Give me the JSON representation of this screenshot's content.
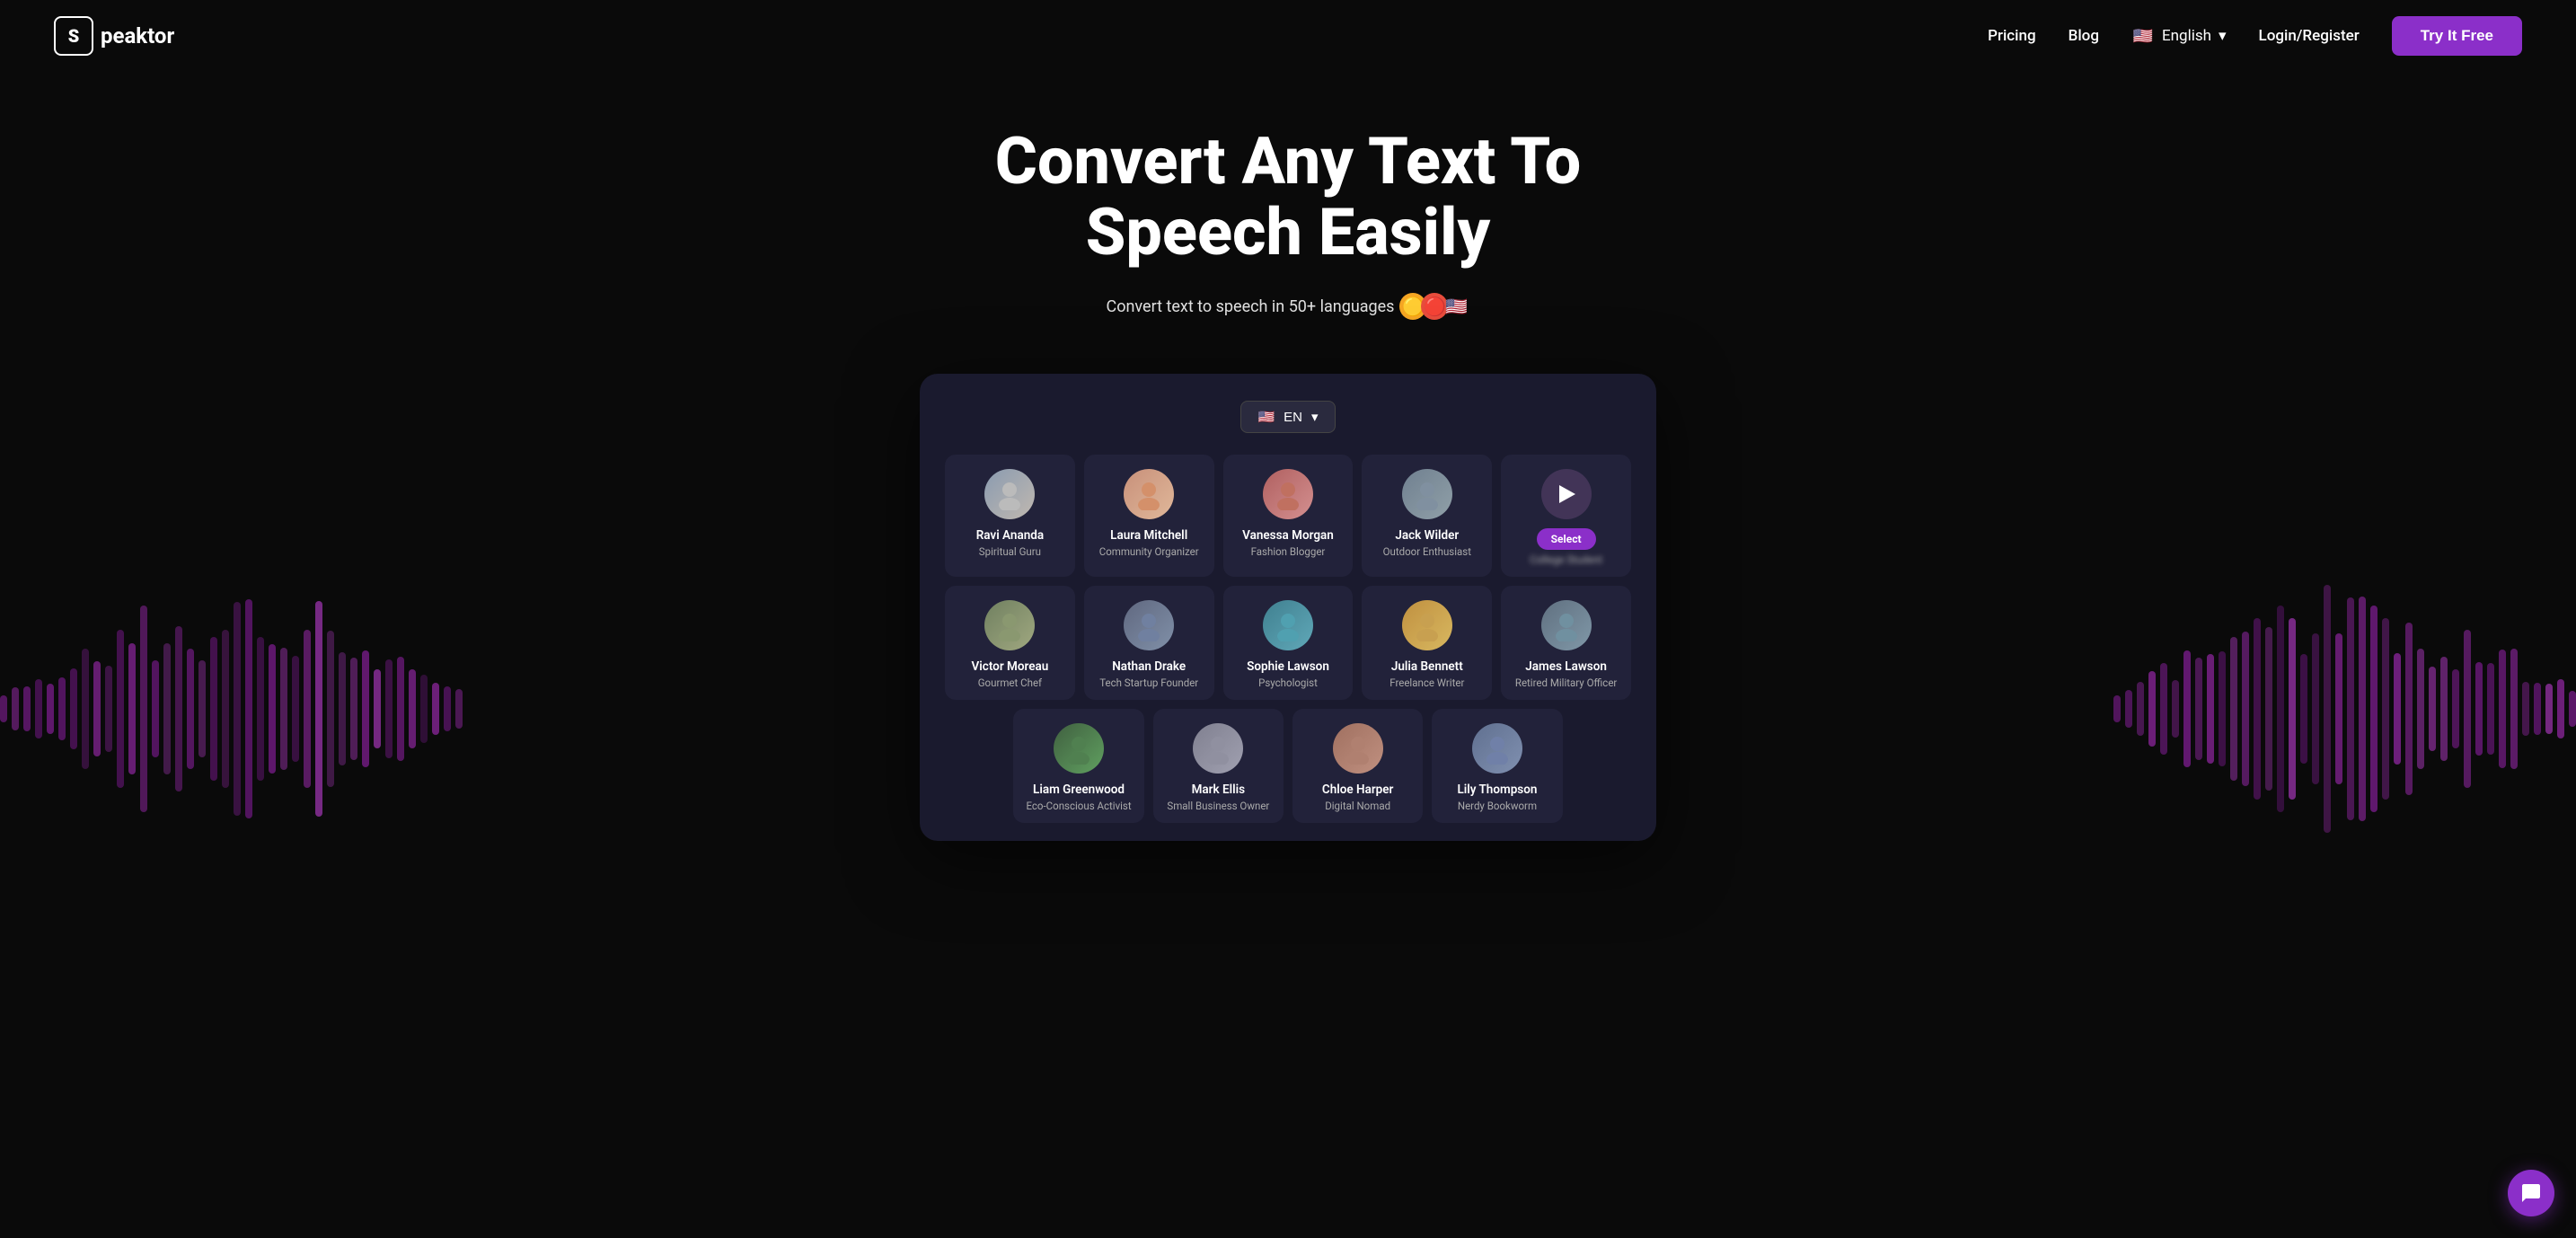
{
  "nav": {
    "logo_letter": "S",
    "logo_text": "peaktor",
    "links": [
      {
        "label": "Pricing",
        "name": "pricing-link"
      },
      {
        "label": "Blog",
        "name": "blog-link"
      }
    ],
    "language": {
      "flag": "🇺🇸",
      "label": "English",
      "chevron": "▾"
    },
    "login_label": "Login/Register",
    "try_btn": "Try It Free"
  },
  "hero": {
    "title": "Convert Any Text To Speech Easily",
    "subtitle": "Convert text to speech in 50+ languages",
    "flags": [
      "🟡",
      "🔴",
      "🇺🇸"
    ]
  },
  "card": {
    "lang_flag": "🇺🇸",
    "lang_code": "EN",
    "lang_chevron": "▾",
    "voices_row1": [
      {
        "name": "Ravi Ananda",
        "role": "Spiritual Guru",
        "avatar": "👴"
      },
      {
        "name": "Laura Mitchell",
        "role": "Community Organizer",
        "avatar": "👩"
      },
      {
        "name": "Vanessa Morgan",
        "role": "Fashion Blogger",
        "avatar": "👩‍🦱"
      },
      {
        "name": "Jack Wilder",
        "role": "Outdoor Enthusiast",
        "avatar": "🧔"
      },
      {
        "name": "Select",
        "role": "College Student",
        "avatar": null,
        "is_select": true
      }
    ],
    "voices_row2": [
      {
        "name": "Victor Moreau",
        "role": "Gourmet Chef",
        "avatar": "👨‍🍳"
      },
      {
        "name": "Nathan Drake",
        "role": "Tech Startup Founder",
        "avatar": "👨"
      },
      {
        "name": "Sophie Lawson",
        "role": "Psychologist",
        "avatar": "👩‍💼"
      },
      {
        "name": "Julia Bennett",
        "role": "Freelance Writer",
        "avatar": "👩"
      },
      {
        "name": "James Lawson",
        "role": "Retired Military Officer",
        "avatar": "👨‍💼"
      }
    ],
    "voices_row3": [
      {
        "name": "Liam Greenwood",
        "role": "Eco-Conscious Activist",
        "avatar": "👦"
      },
      {
        "name": "Mark Ellis",
        "role": "Small Business Owner",
        "avatar": "👨"
      },
      {
        "name": "Chloe Harper",
        "role": "Digital Nomad",
        "avatar": "👩"
      },
      {
        "name": "Lily Thompson",
        "role": "Nerdy Bookworm",
        "avatar": "👩‍🔬"
      }
    ]
  },
  "chat": {
    "icon": "💬"
  }
}
